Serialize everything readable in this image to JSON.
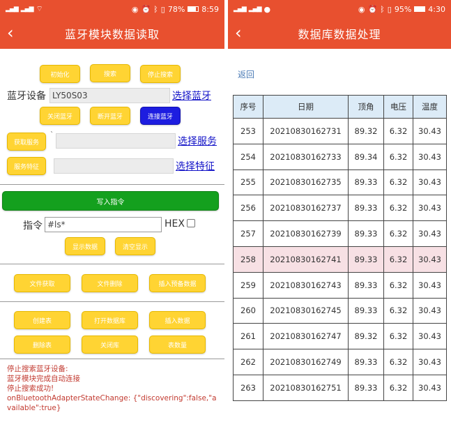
{
  "left": {
    "status": {
      "time": "8:59",
      "battery": "78%",
      "battery_level": 0.78
    },
    "title": "蓝牙模块数据读取",
    "buttons": {
      "init": "初始化",
      "search": "搜索",
      "stop_search": "停止搜索",
      "close_bt": "关闭蓝牙",
      "disconnect_bt": "断开蓝牙",
      "connect_bt": "连接蓝牙",
      "get_service": "获取服务",
      "service_char": "服务特征",
      "write_cmd": "写入指令",
      "show_data": "显示数据",
      "clear_display": "清空显示",
      "file_get": "文件获取",
      "file_delete": "文件删除",
      "insert_preset": "插入预备数据",
      "create_table": "创建表",
      "open_db": "打开数据库",
      "insert_data": "插入数据",
      "delete_table": "删除表",
      "close_db": "关闭库",
      "table_count": "表数量"
    },
    "labels": {
      "device": "蓝牙设备",
      "device_name": "LY50S03",
      "select_bt": "选择蓝牙",
      "select_service": "选择服务",
      "select_char": "选择特征",
      "service_value": "`",
      "command": "指令",
      "command_value": "#ls*",
      "hex": "HEX"
    },
    "log": [
      "停止搜索蓝牙设备:",
      "蓝牙模块完成自动连接",
      "停止搜索成功!",
      "onBluetoothAdapterStateChange: {\"discovering\":false,\"available\":true}"
    ]
  },
  "right": {
    "status": {
      "time": "4:30",
      "battery": "95%",
      "battery_level": 0.95
    },
    "title": "数据库数据处理",
    "back_link": "返回",
    "table": {
      "headers": [
        "序号",
        "日期",
        "顶角",
        "电压",
        "温度"
      ],
      "rows": [
        [
          "253",
          "20210830162731",
          "89.32",
          "6.32",
          "30.43"
        ],
        [
          "254",
          "20210830162733",
          "89.34",
          "6.32",
          "30.43"
        ],
        [
          "255",
          "20210830162735",
          "89.33",
          "6.32",
          "30.43"
        ],
        [
          "256",
          "20210830162737",
          "89.33",
          "6.32",
          "30.43"
        ],
        [
          "257",
          "20210830162739",
          "89.33",
          "6.32",
          "30.43"
        ],
        [
          "258",
          "20210830162741",
          "89.33",
          "6.32",
          "30.43"
        ],
        [
          "259",
          "20210830162743",
          "89.33",
          "6.32",
          "30.43"
        ],
        [
          "260",
          "20210830162745",
          "89.33",
          "6.32",
          "30.43"
        ],
        [
          "261",
          "20210830162747",
          "89.32",
          "6.32",
          "30.43"
        ],
        [
          "262",
          "20210830162749",
          "89.33",
          "6.32",
          "30.43"
        ],
        [
          "263",
          "20210830162751",
          "89.33",
          "6.32",
          "30.43"
        ]
      ],
      "highlighted_row": "258"
    }
  },
  "colors": {
    "appbar": "#e8502f",
    "button_yellow": "#ffd433",
    "button_blue": "#1d1de0",
    "button_green": "#14a01e",
    "log_red": "#c23a30",
    "highlight_row": "#f7e0e4",
    "header_bg": "#dcebf7"
  }
}
